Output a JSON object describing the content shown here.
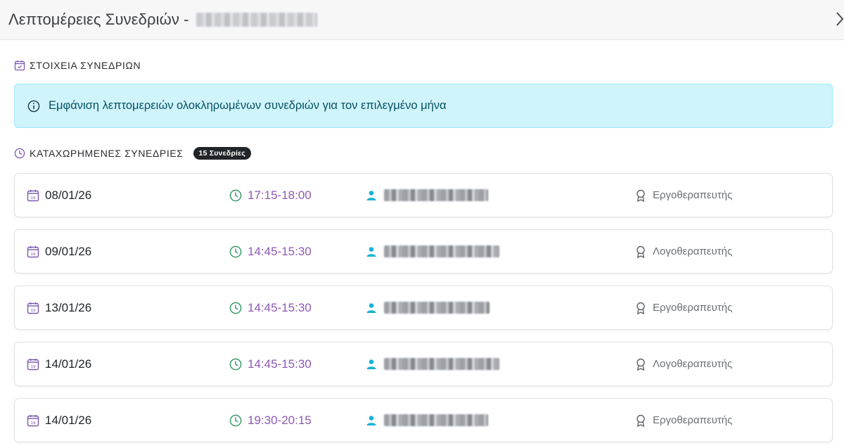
{
  "header": {
    "title": "Λεπτομέρειες Συνεδριών -"
  },
  "details_section": {
    "heading": "ΣΤΟΙΧΕΙΑ ΣΥΝΕΔΡΙΩΝ",
    "info_text": "Εμφάνιση λεπτομερειών ολοκληρωμένων συνεδριών για τον επιλεγμένο μήνα"
  },
  "sessions_section": {
    "heading": "ΚΑΤΑΧΩΡΗΜΕΝΕΣ ΣΥΝΕΔΡΙΕΣ",
    "count_badge": "15 Συνεδρίες"
  },
  "sessions": [
    {
      "date": "08/01/26",
      "time": "17:15-18:00",
      "role": "Εργοθεραπευτής"
    },
    {
      "date": "09/01/26",
      "time": "14:45-15:30",
      "role": "Λογοθεραπευτής"
    },
    {
      "date": "13/01/26",
      "time": "14:45-15:30",
      "role": "Εργοθεραπευτής"
    },
    {
      "date": "14/01/26",
      "time": "14:45-15:30",
      "role": "Λογοθεραπευτής"
    },
    {
      "date": "14/01/26",
      "time": "19:30-20:15",
      "role": "Εργοθεραπευτής"
    }
  ],
  "colors": {
    "accent_purple": "#8e59b6",
    "clock_green": "#3a9b6a",
    "person_cyan": "#17b3d6",
    "alert_bg": "#cff4fc",
    "alert_text": "#055160"
  }
}
